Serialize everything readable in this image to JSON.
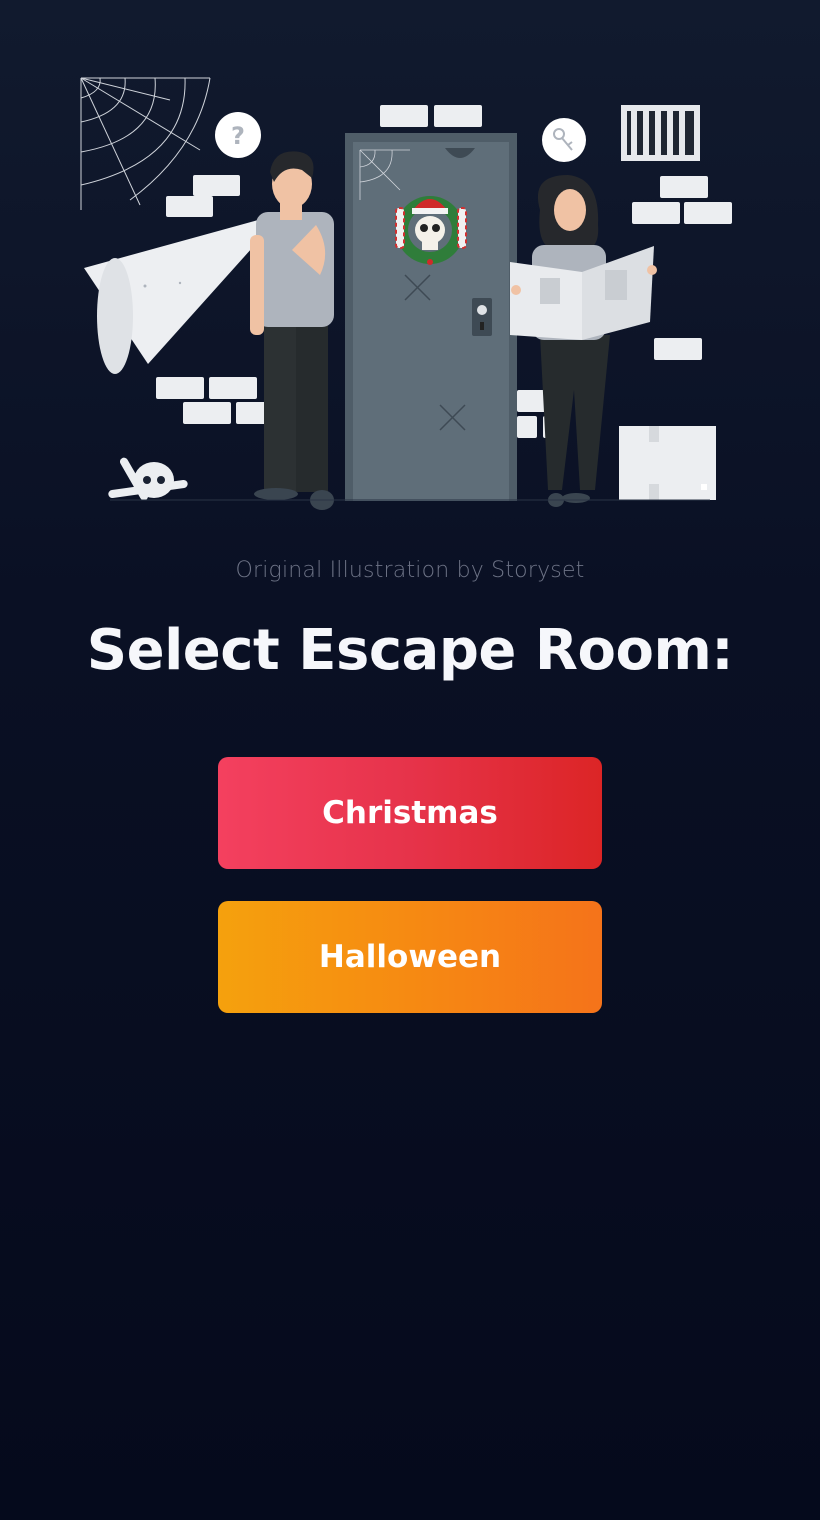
{
  "illustration": {
    "description_icons": [
      "cobweb-icon",
      "question-bubble-icon",
      "key-bubble-icon",
      "barred-window-icon",
      "skull-wreath-icon",
      "skull-bones-icon",
      "flashlight-icon",
      "box-icon"
    ]
  },
  "credit": "Original Illustration by Storyset",
  "title": "Select Escape Room:",
  "rooms": [
    {
      "label": "Christmas",
      "color_start": "#f4405f",
      "color_end": "#dc2526"
    },
    {
      "label": "Halloween",
      "color_start": "#f5a10d",
      "color_end": "#f5731a"
    }
  ]
}
